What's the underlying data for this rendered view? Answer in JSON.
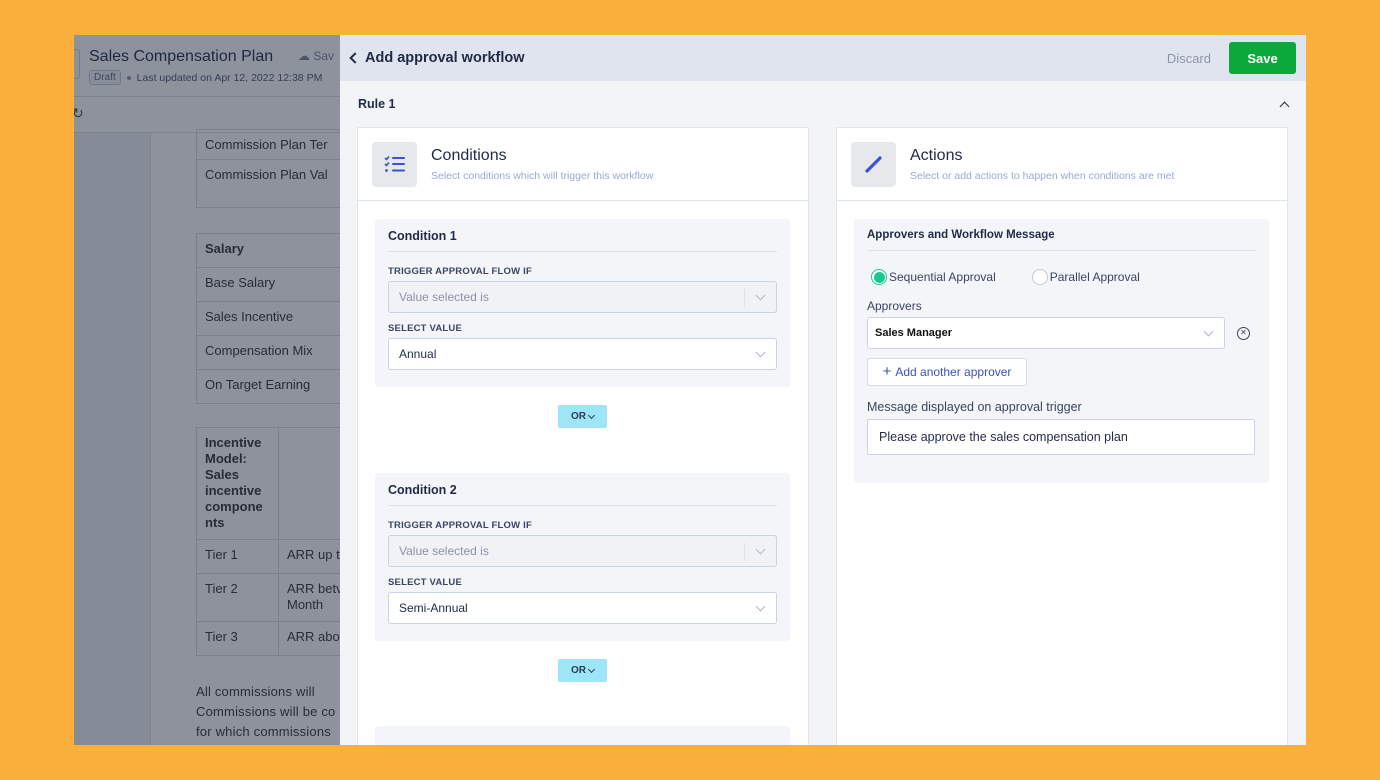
{
  "background_doc": {
    "title": "Sales Compensation Plan",
    "save_label": "Sav",
    "status_badge": "Draft",
    "last_updated": "Last updated on Apr 12, 2022 12:38 PM",
    "plan_rows": [
      "Commission Plan Ter",
      "Commission Plan Val"
    ],
    "salary_table": {
      "header": "Salary",
      "rows": [
        "Base Salary",
        "Sales Incentive",
        "Compensation Mix",
        "On Target Earning"
      ]
    },
    "incentive_table": {
      "header": "Incentive Model: Sales incentive compone nts",
      "header_lines": [
        "Incentive",
        "Model:",
        "Sales",
        "incentive",
        "compone",
        "nts"
      ],
      "rows": [
        {
          "tier": "Tier 1",
          "desc": "ARR up t"
        },
        {
          "tier": "Tier 2",
          "desc": "ARR betv",
          "desc2": "Month"
        },
        {
          "tier": "Tier 3",
          "desc": "ARR abo"
        }
      ]
    },
    "paragraph_lines": [
      "All  commissions  will",
      "Commissions will be co",
      "for which commissions"
    ]
  },
  "drawer": {
    "title": "Add approval workflow",
    "discard_label": "Discard",
    "save_label": "Save",
    "rule_title": "Rule 1"
  },
  "conditions": {
    "title": "Conditions",
    "subtitle": "Select conditions which will trigger this workflow",
    "items": [
      {
        "title": "Condition 1",
        "trigger_label": "TRIGGER APPROVAL FLOW IF",
        "trigger_value": "Value selected is",
        "value_label": "SELECT VALUE",
        "value": "Annual"
      },
      {
        "title": "Condition 2",
        "trigger_label": "TRIGGER APPROVAL FLOW IF",
        "trigger_value": "Value selected is",
        "value_label": "SELECT VALUE",
        "value": "Semi-Annual"
      }
    ],
    "or_label": "OR"
  },
  "actions": {
    "title": "Actions",
    "subtitle": "Select or add actions to happen when conditions are met",
    "card_title": "Approvers and Workflow Message",
    "approval_modes": [
      {
        "label": "Sequential Approval",
        "selected": true
      },
      {
        "label": "Parallel Approval",
        "selected": false
      }
    ],
    "approvers_label": "Approvers",
    "approvers": [
      "Sales Manager"
    ],
    "add_approver_label": "Add another approver",
    "message_label": "Message displayed on approval trigger",
    "message_value": "Please approve the sales compensation plan"
  },
  "colors": {
    "background": "#fcb03c",
    "save_button": "#0aaa3a",
    "or_button": "#9ee5f8",
    "radio_selected": "#18c98f",
    "accent_blue": "#3b50c6",
    "chat_button": "#ff0a6c"
  }
}
